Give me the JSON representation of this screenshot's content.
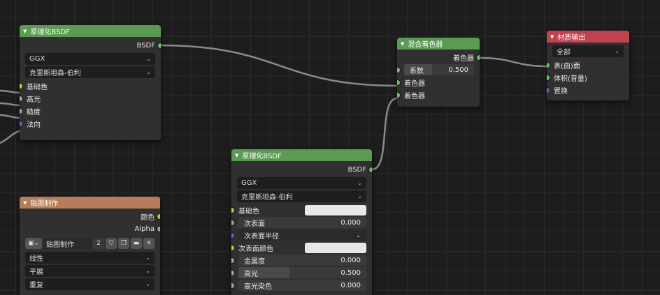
{
  "nodes": {
    "bsdf_a": {
      "title": "原理化BSDF",
      "output": "BSDF",
      "distribution": "GGX",
      "subsurface_method": "克里斯坦森-伯利",
      "inputs": [
        "基础色",
        "高光",
        "糙度",
        "法向"
      ]
    },
    "mix": {
      "title": "混合着色器",
      "output": "着色器",
      "factor_label": "系数",
      "factor_value": "0.500",
      "inputs": [
        "着色器",
        "着色器"
      ]
    },
    "material_output": {
      "title": "材质输出",
      "target": "全部",
      "inputs": [
        "表(曲)面",
        "体积(音量)",
        "置换"
      ]
    },
    "bsdf_b": {
      "title": "原理化BSDF",
      "output": "BSDF",
      "distribution": "GGX",
      "subsurface_method": "克里斯坦森-伯利",
      "base_color_label": "基础色",
      "subsurface_label": "次表面",
      "subsurface_value": "0.000",
      "subsurface_radius_label": "次表面半径",
      "subsurface_color_label": "次表面颜色",
      "metallic_label": "金属度",
      "metallic_value": "0.000",
      "specular_label": "高光",
      "specular_value": "0.500",
      "specular_tint_label": "高光染色",
      "specular_tint_value": "0.000"
    },
    "image_texture": {
      "title": "贴图制作",
      "outputs": [
        "颜色",
        "Alpha"
      ],
      "image_name": "贴图制作",
      "users": "2",
      "interpolation": "线性",
      "projection": "平展",
      "extension": "重复"
    }
  },
  "colors": {
    "shader_socket": "#62c862",
    "color_socket": "#c8c629",
    "float_socket": "#a1a1a1",
    "vector_socket": "#6363c7",
    "header_shader": "#5a9a52",
    "header_output": "#c2414f",
    "header_texture": "#b67d5a"
  }
}
